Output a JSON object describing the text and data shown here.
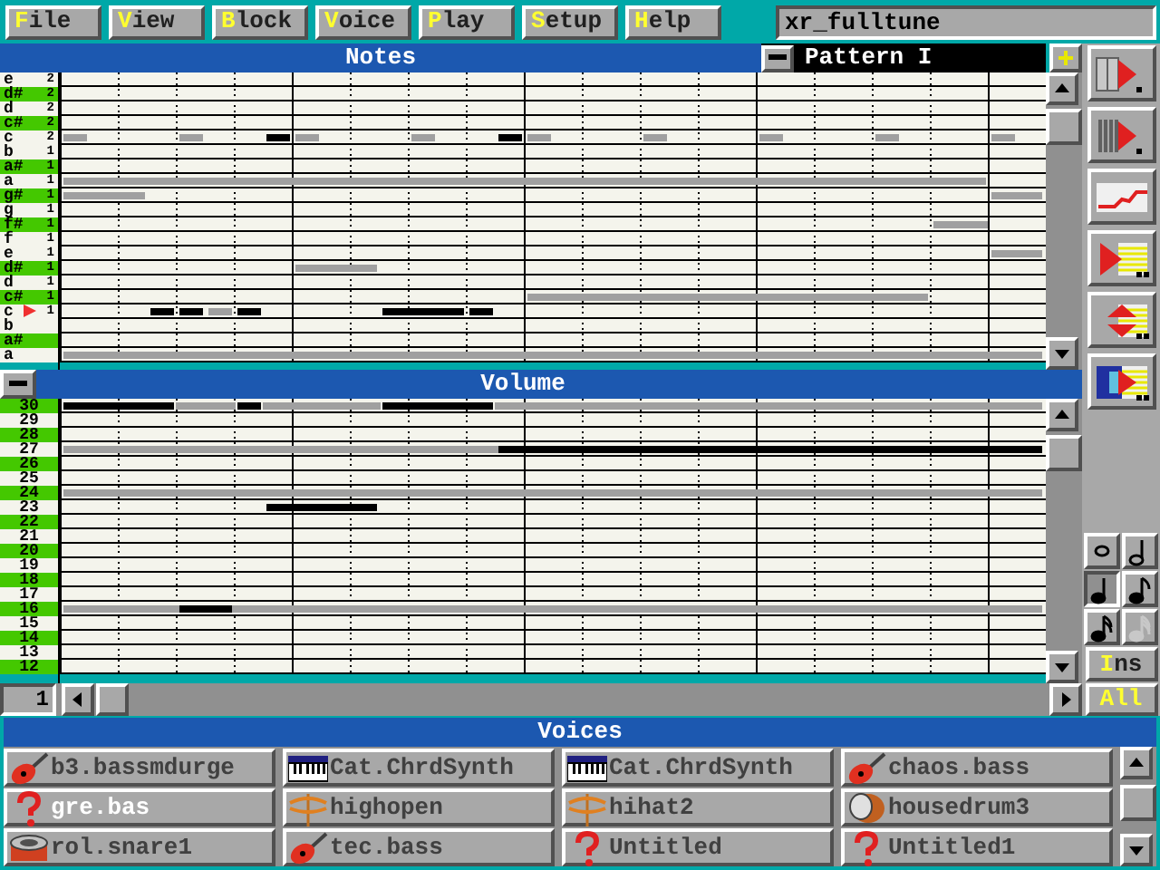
{
  "menu": [
    {
      "label": "File"
    },
    {
      "label": "View"
    },
    {
      "label": "Block"
    },
    {
      "label": "Voice"
    },
    {
      "label": "Play"
    },
    {
      "label": "Setup"
    },
    {
      "label": "Help"
    }
  ],
  "title_field": {
    "value": "xr_fulltune"
  },
  "notes_panel": {
    "title": "Notes",
    "pattern": "Pattern I",
    "rows": [
      {
        "note": "e",
        "octave": "2",
        "sharp": false,
        "marker": false
      },
      {
        "note": "d#",
        "octave": "2",
        "sharp": true,
        "marker": false
      },
      {
        "note": "d",
        "octave": "2",
        "sharp": false,
        "marker": false
      },
      {
        "note": "c#",
        "octave": "2",
        "sharp": true,
        "marker": false
      },
      {
        "note": "c",
        "octave": "2",
        "sharp": false,
        "marker": false
      },
      {
        "note": "b",
        "octave": "1",
        "sharp": false,
        "marker": false
      },
      {
        "note": "a#",
        "octave": "1",
        "sharp": true,
        "marker": false
      },
      {
        "note": "a",
        "octave": "1",
        "sharp": false,
        "marker": false
      },
      {
        "note": "g#",
        "octave": "1",
        "sharp": true,
        "marker": false
      },
      {
        "note": "g",
        "octave": "1",
        "sharp": false,
        "marker": false
      },
      {
        "note": "f#",
        "octave": "1",
        "sharp": true,
        "marker": false
      },
      {
        "note": "f",
        "octave": "1",
        "sharp": false,
        "marker": false
      },
      {
        "note": "e",
        "octave": "1",
        "sharp": false,
        "marker": false
      },
      {
        "note": "d#",
        "octave": "1",
        "sharp": true,
        "marker": false
      },
      {
        "note": "d",
        "octave": "1",
        "sharp": false,
        "marker": false
      },
      {
        "note": "c#",
        "octave": "1",
        "sharp": true,
        "marker": false
      },
      {
        "note": "c",
        "octave": "1",
        "sharp": false,
        "marker": true
      },
      {
        "note": "b",
        "sharp": false,
        "marker": false
      },
      {
        "note": "a#",
        "sharp": true,
        "marker": false
      },
      {
        "note": "a",
        "sharp": false,
        "marker": false
      }
    ]
  },
  "volume_panel": {
    "title": "Volume",
    "rows": [
      {
        "label": "30",
        "highlighted": true
      },
      {
        "label": "29",
        "highlighted": false
      },
      {
        "label": "28",
        "highlighted": true
      },
      {
        "label": "27",
        "highlighted": false
      },
      {
        "label": "26",
        "highlighted": true
      },
      {
        "label": "25",
        "highlighted": false
      },
      {
        "label": "24",
        "highlighted": true
      },
      {
        "label": "23",
        "highlighted": false
      },
      {
        "label": "22",
        "highlighted": true
      },
      {
        "label": "21",
        "highlighted": false
      },
      {
        "label": "20",
        "highlighted": true
      },
      {
        "label": "19",
        "highlighted": false
      },
      {
        "label": "18",
        "highlighted": true
      },
      {
        "label": "17",
        "highlighted": false
      },
      {
        "label": "16",
        "highlighted": true
      },
      {
        "label": "15",
        "highlighted": false
      },
      {
        "label": "14",
        "highlighted": true
      },
      {
        "label": "13",
        "highlighted": false
      },
      {
        "label": "12",
        "highlighted": true
      }
    ]
  },
  "position_field": {
    "value": "1"
  },
  "tools": [
    {
      "kind": "keyboard"
    },
    {
      "kind": "piano"
    },
    {
      "kind": "curve"
    },
    {
      "kind": "grid"
    },
    {
      "kind": "updown"
    },
    {
      "kind": "window"
    }
  ],
  "note_lengths": [
    {
      "kind": "whole",
      "selected": false,
      "disabled": false
    },
    {
      "kind": "half",
      "selected": false,
      "disabled": false
    },
    {
      "kind": "quarter",
      "selected": true,
      "disabled": false
    },
    {
      "kind": "eighth",
      "selected": false,
      "disabled": false
    },
    {
      "kind": "sixteenth",
      "selected": false,
      "disabled": false
    },
    {
      "kind": "thirtysecond",
      "selected": false,
      "disabled": true
    }
  ],
  "ins_button": "Ins",
  "all_button": "All",
  "voices": {
    "title": "Voices",
    "items": [
      {
        "name": "b3.bassmdurge",
        "kind": "guitar",
        "selected": false
      },
      {
        "name": "Cat.ChrdSynth",
        "kind": "keyboard",
        "selected": false
      },
      {
        "name": "Cat.ChrdSynth",
        "kind": "keyboard",
        "selected": false
      },
      {
        "name": "chaos.bass",
        "kind": "guitar",
        "selected": false
      },
      {
        "name": "gre.bas",
        "kind": "unknown",
        "selected": true
      },
      {
        "name": "highopen",
        "kind": "cymbal",
        "selected": false
      },
      {
        "name": "hihat2",
        "kind": "cymbal",
        "selected": false
      },
      {
        "name": "housedrum3",
        "kind": "drum",
        "selected": false
      },
      {
        "name": "rol.snare1",
        "kind": "snare",
        "selected": false
      },
      {
        "name": "tec.bass",
        "kind": "guitar",
        "selected": false
      },
      {
        "name": "Untitled",
        "kind": "unknown",
        "selected": false
      },
      {
        "name": "Untitled1",
        "kind": "unknown",
        "selected": false
      }
    ]
  }
}
